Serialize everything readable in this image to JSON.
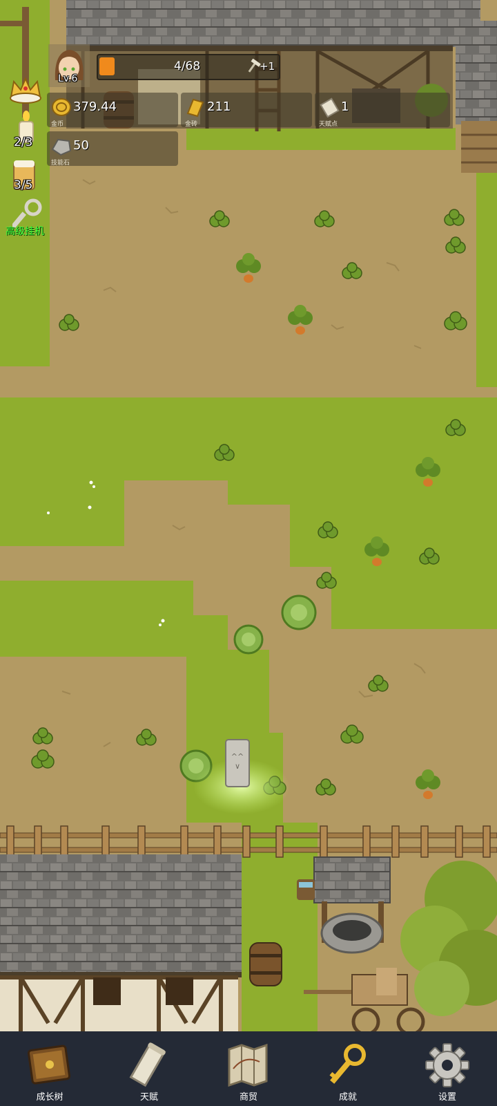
{
  "player": {
    "level": "Lv.6"
  },
  "progress": {
    "text": "4/68",
    "bonus": "+1",
    "fraction": 0.06
  },
  "resources": [
    {
      "value": "379.44",
      "caption": "金币",
      "icon": "gold-coin-icon"
    },
    {
      "value": "211",
      "caption": "金砖",
      "icon": "gold-bar-icon"
    },
    {
      "value": "1",
      "caption": "天赋点",
      "icon": "talent-scroll-icon"
    },
    {
      "value": "50",
      "caption": "技能石",
      "icon": "skill-stone-icon"
    }
  ],
  "side": {
    "candle_count": "2/3",
    "beer_count": "3/5",
    "idle_label": "高级挂机"
  },
  "nav": [
    {
      "label": "成长树",
      "icon": "growth-book-icon"
    },
    {
      "label": "天赋",
      "icon": "talent-scroll-icon"
    },
    {
      "label": "商贸",
      "icon": "trade-map-icon"
    },
    {
      "label": "成就",
      "icon": "achievement-key-icon"
    },
    {
      "label": "设置",
      "icon": "settings-gear-icon"
    }
  ],
  "colors": {
    "soil": "#b39a63",
    "grass": "#8fae2e",
    "roof": "#6e6e6a",
    "nav_bg": "#242a36",
    "idle_label": "#3cff3c"
  }
}
